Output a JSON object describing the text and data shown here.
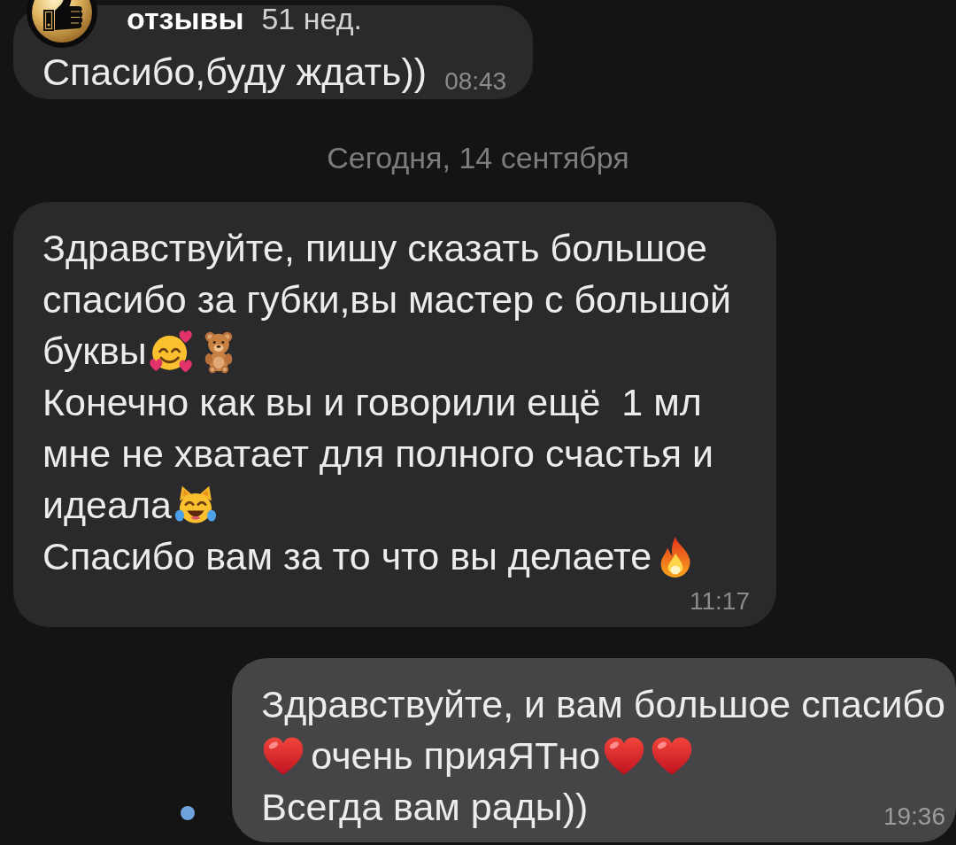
{
  "story_header": {
    "title": "отзывы",
    "age": "51 нед."
  },
  "chat": [
    {
      "kind": "incoming",
      "unread": false,
      "lines": [
        [
          {
            "kind": "text",
            "text": "Спасибо,буду ждать))"
          }
        ]
      ],
      "time": "08:43"
    },
    {
      "kind": "date",
      "text": "Сегодня, 14 сентября"
    },
    {
      "kind": "incoming",
      "unread": false,
      "lines": [
        [
          {
            "kind": "text",
            "text": "Здравствуйте, пишу сказать большое"
          }
        ],
        [
          {
            "kind": "text",
            "text": "спасибо за губки,вы мастер с большой"
          }
        ],
        [
          {
            "kind": "text",
            "text": "буквы"
          },
          {
            "kind": "heartface"
          },
          {
            "kind": "teddy"
          }
        ],
        [
          {
            "kind": "text",
            "text": "Конечно как вы и говорили ещё  1 мл"
          }
        ],
        [
          {
            "kind": "text",
            "text": "мне не хватает для полного счастья и"
          }
        ],
        [
          {
            "kind": "text",
            "text": "идеала"
          },
          {
            "kind": "catjoy"
          }
        ],
        [
          {
            "kind": "text",
            "text": "Спасибо вам за то что вы делаете"
          },
          {
            "kind": "fire"
          }
        ]
      ],
      "time": "11:17"
    },
    {
      "kind": "outgoing",
      "unread": true,
      "lines": [
        [
          {
            "kind": "text",
            "text": "Здравствуйте, и вам большое спасибо"
          }
        ],
        [
          {
            "kind": "heart"
          },
          {
            "kind": "text",
            "text": "очень прияЯТно"
          },
          {
            "kind": "heart"
          },
          {
            "kind": "heart"
          }
        ],
        [
          {
            "kind": "text",
            "text": "Всегда вам рады))"
          }
        ]
      ],
      "time": "19:36"
    }
  ]
}
